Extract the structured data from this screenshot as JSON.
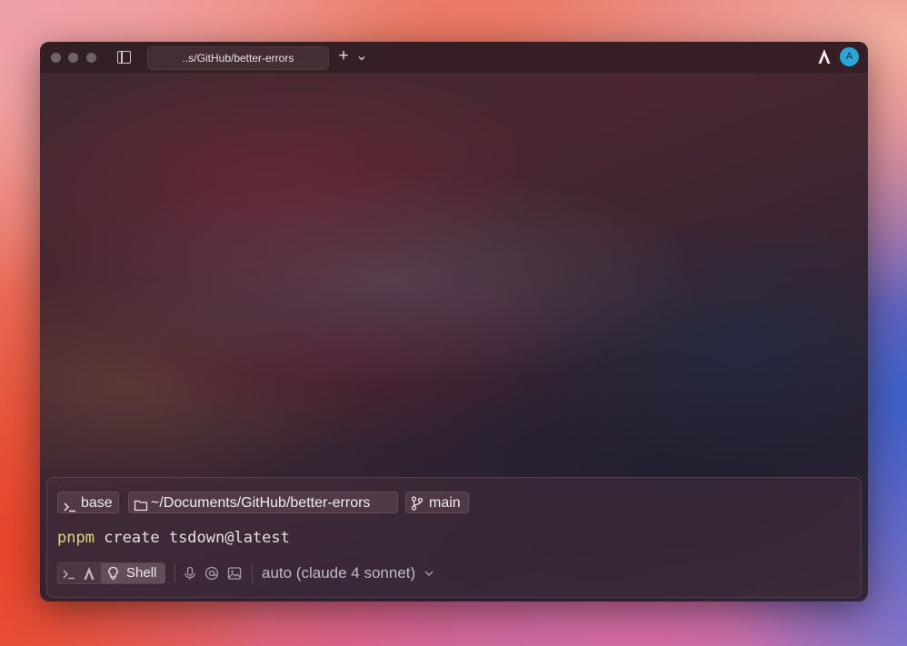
{
  "window": {
    "tab_title": "..s/GitHub/better-errors",
    "avatar_letter": "A"
  },
  "context_chips": {
    "env_label": "base",
    "path_label": "~/Documents/GitHub/better-errors",
    "branch_label": "main"
  },
  "prompt": {
    "command_head": "pnpm",
    "command_rest": " create tsdown@latest"
  },
  "toolbar": {
    "mode_label": "Shell",
    "model_label": "auto (claude 4 sonnet)"
  },
  "colors": {
    "accent_avatar": "#2aa6d8",
    "command_highlight": "#d8db7a"
  },
  "icons": [
    "sidebar-toggle-icon",
    "plus-icon",
    "chevron-down-icon",
    "warp-logo-icon",
    "terminal-prompt-icon",
    "folder-icon",
    "git-branch-icon",
    "lightbulb-icon",
    "microphone-icon",
    "at-icon",
    "image-icon"
  ]
}
